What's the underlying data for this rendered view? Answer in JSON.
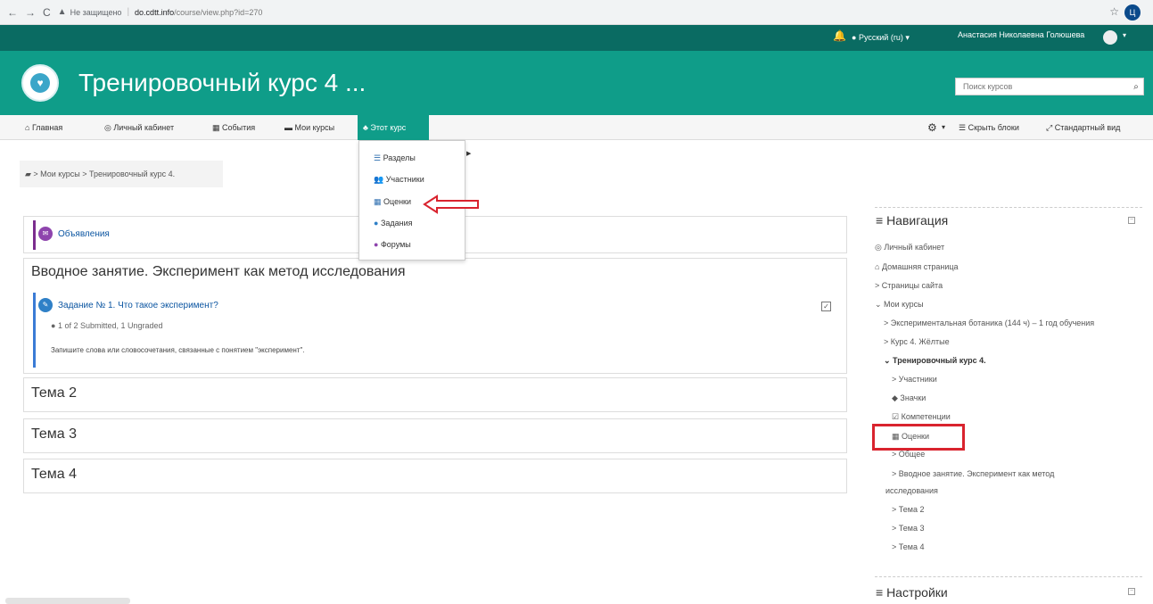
{
  "browser": {
    "security": "Не защищено",
    "url_host": "do.cdtt.info",
    "url_path": "/course/view.php?id=270",
    "profile_letter": "Ц"
  },
  "topbar": {
    "language": "Русский (ru)",
    "user_name": "Анастасия Николаевна Голюшева"
  },
  "header": {
    "course_title": "Тренировочный курс 4 ...",
    "search_placeholder": "Поиск курсов"
  },
  "navbar": {
    "items": [
      "Главная",
      "Личный кабинет",
      "События",
      "Мои курсы",
      "Этот курс"
    ],
    "hide_blocks": "Скрыть блоки",
    "standard_view": "Стандартный вид"
  },
  "breadcrumb": {
    "path": "> Мои курсы > Тренировочный курс 4."
  },
  "dropdown": {
    "items": [
      "Разделы",
      "Участники",
      "Оценки",
      "Задания",
      "Форумы"
    ]
  },
  "course": {
    "announcements": "Объявления",
    "intro_section": "Вводное занятие. Эксперимент как метод исследования",
    "task_title": "Задание № 1. Что такое эксперимент?",
    "task_status": "1 of 2 Submitted, 1 Ungraded",
    "task_desc": "Запишите слова или словосочетания, связанные с понятием \"эксперимент\".",
    "sections": [
      "Тема 2",
      "Тема 3",
      "Тема 4"
    ]
  },
  "navigation": {
    "heading": "Навигация",
    "items": [
      "Личный кабинет",
      "Домашняя страница",
      "> Страницы сайта",
      "Мои курсы",
      "> Экспериментальная ботаника (144 ч) – 1 год обучения",
      "> Курс 4. Жёлтые",
      "Тренировочный курс 4.",
      "> Участники",
      "Значки",
      "Компетенции",
      "Оценки",
      "> Общее",
      "> Вводное занятие. Эксперимент как метод",
      "исследования",
      "> Тема 2",
      "> Тема 3",
      "> Тема 4"
    ]
  },
  "settings": {
    "heading": "Настройки"
  },
  "colors": {
    "topbar": "#0a6b62",
    "header": "#0f9d89",
    "link": "#0b55a1",
    "highlight": "#d9232e"
  }
}
